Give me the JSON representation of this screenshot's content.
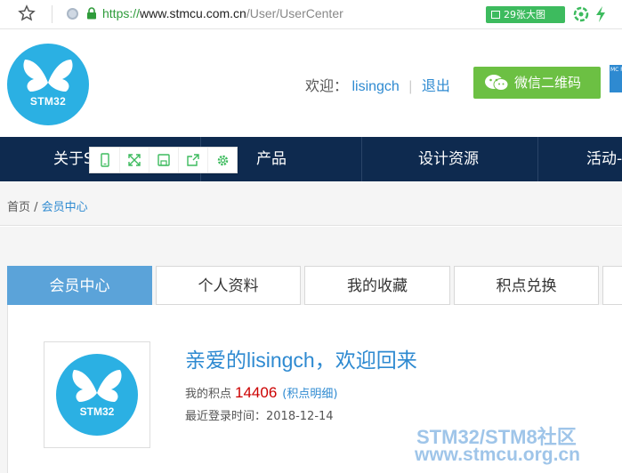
{
  "browser": {
    "url_scheme": "https://",
    "url_host": "www.stmcu.com.cn",
    "url_path": "/User/UserCenter",
    "image_button": "29张大图"
  },
  "header": {
    "logo_text": "STM32",
    "welcome_prefix": "欢迎：",
    "username": "lisingch",
    "separator": "|",
    "logout": "退出",
    "wechat_button": "微信二维码",
    "side_badge": "MC Fin"
  },
  "nav": {
    "items": [
      "关于S",
      "产品",
      "设计资源",
      "活动-"
    ]
  },
  "breadcrumb": {
    "home": "首页",
    "separator": " / ",
    "current": "会员中心"
  },
  "tabs": [
    "会员中心",
    "个人资料",
    "我的收藏",
    "积点兑换"
  ],
  "profile": {
    "avatar_text": "STM32",
    "greeting": "亲爱的lisingch，欢迎回来",
    "points_label": "我的积点",
    "points_value": "14406",
    "points_detail": "(积点明细)",
    "last_login": "最近登录时间：2018-12-14"
  },
  "watermark": {
    "line1": "STM32/STM8社区",
    "line2": "www.stmcu.org.cn"
  },
  "colors": {
    "nav_bg": "#0e2a4f",
    "link_blue": "#2e8ad1",
    "tab_active": "#5ba3d9",
    "wechat_green": "#6cc043",
    "logo_blue": "#2bb0e3",
    "points_red": "#cc0000"
  }
}
